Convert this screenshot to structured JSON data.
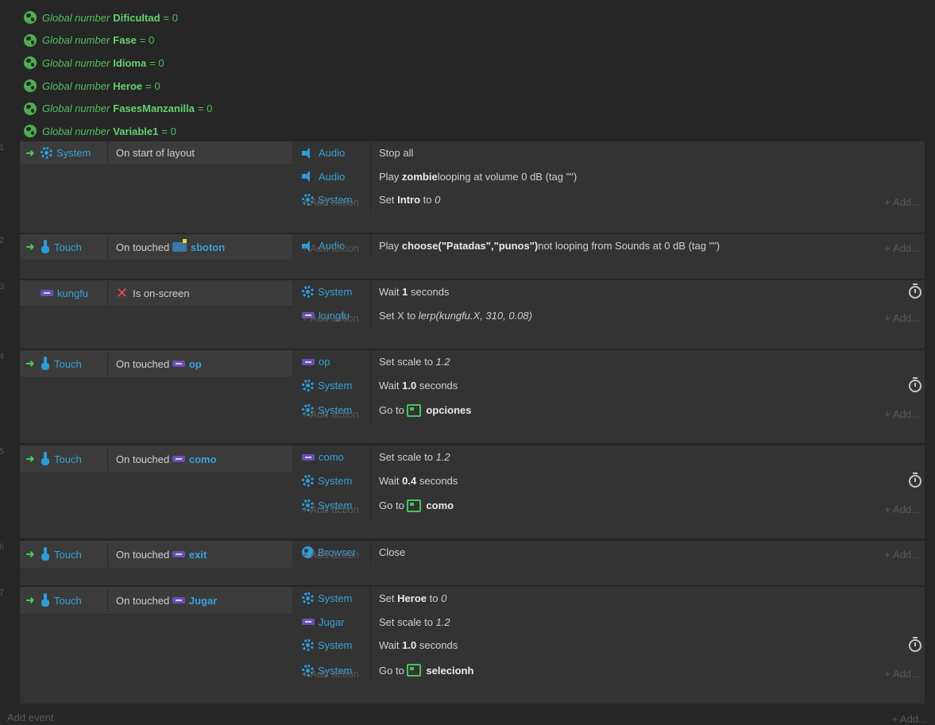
{
  "global_vars": [
    {
      "prefix": "Global number",
      "name": "Dificultad",
      "value": "= 0"
    },
    {
      "prefix": "Global number",
      "name": "Fase",
      "value": "= 0"
    },
    {
      "prefix": "Global number",
      "name": "Idioma",
      "value": "= 0"
    },
    {
      "prefix": "Global number",
      "name": "Heroe",
      "value": "= 0"
    },
    {
      "prefix": "Global number",
      "name": "FasesManzanilla",
      "value": "= 0"
    },
    {
      "prefix": "Global number",
      "name": "Variable1",
      "value": "= 0"
    }
  ],
  "labels": {
    "add_action": "+ Add action",
    "add_more": "+ Add...",
    "add_event": "Add event",
    "arrow": "➜"
  },
  "events": [
    {
      "number": "1",
      "cond_object": "System",
      "cond_text": "On start of layout",
      "cond_target": "",
      "actions": [
        {
          "object": "Audio",
          "pre": "Stop all",
          "bold": "",
          "mid": "",
          "ital": ""
        },
        {
          "object": "Audio",
          "pre": "Play ",
          "bold": "zombie",
          "mid": " looping at volume 0 dB (tag \"\")",
          "ital": ""
        },
        {
          "object": "System",
          "pre": "Set ",
          "bold": "Intro",
          "mid": " to ",
          "ital": "0"
        }
      ]
    },
    {
      "number": "2",
      "cond_object": "Touch",
      "cond_text": "On touched",
      "cond_target": "sboton",
      "actions": [
        {
          "object": "Audio",
          "pre": "Play ",
          "bold": "choose(\"Patadas\",\"punos\")",
          "mid": " not looping from Sounds at 0 dB (tag \"\")",
          "ital": ""
        }
      ]
    },
    {
      "number": "3",
      "cond_object": "kungfu",
      "cond_text": "Is on-screen",
      "cond_target": "",
      "actions": [
        {
          "object": "System",
          "pre": "Wait ",
          "bold": "1",
          "mid": " seconds",
          "ital": ""
        },
        {
          "object": "kungfu",
          "pre": "Set X to ",
          "bold": "",
          "mid": "",
          "ital": "lerp(kungfu.X, 310, 0.08)"
        }
      ]
    },
    {
      "number": "4",
      "cond_object": "Touch",
      "cond_text": "On touched",
      "cond_target": "op",
      "actions": [
        {
          "object": "op",
          "pre": "Set scale to ",
          "bold": "",
          "mid": "",
          "ital": "1.2"
        },
        {
          "object": "System",
          "pre": "Wait ",
          "bold": "1.0",
          "mid": " seconds",
          "ital": ""
        },
        {
          "object": "System",
          "pre": "Go to ",
          "bold": "opciones",
          "mid": "",
          "ital": ""
        }
      ]
    },
    {
      "number": "5",
      "cond_object": "Touch",
      "cond_text": "On touched",
      "cond_target": "como",
      "actions": [
        {
          "object": "como",
          "pre": "Set scale to ",
          "bold": "",
          "mid": "",
          "ital": "1.2"
        },
        {
          "object": "System",
          "pre": "Wait ",
          "bold": "0.4",
          "mid": " seconds",
          "ital": ""
        },
        {
          "object": "System",
          "pre": "Go to ",
          "bold": "como",
          "mid": "",
          "ital": ""
        }
      ]
    },
    {
      "number": "6",
      "cond_object": "Touch",
      "cond_text": "On touched",
      "cond_target": "exit",
      "actions": [
        {
          "object": "Browser",
          "pre": "Close",
          "bold": "",
          "mid": "",
          "ital": ""
        }
      ]
    },
    {
      "number": "7",
      "cond_object": "Touch",
      "cond_text": "On touched",
      "cond_target": "Jugar",
      "actions": [
        {
          "object": "System",
          "pre": "Set ",
          "bold": "Heroe",
          "mid": " to ",
          "ital": "0"
        },
        {
          "object": "Jugar",
          "pre": "Set scale to ",
          "bold": "",
          "mid": "",
          "ital": "1.2"
        },
        {
          "object": "System",
          "pre": "Wait ",
          "bold": "1.0",
          "mid": " seconds",
          "ital": ""
        },
        {
          "object": "System",
          "pre": "Go to ",
          "bold": "selecionh",
          "mid": "",
          "ital": ""
        }
      ]
    }
  ]
}
